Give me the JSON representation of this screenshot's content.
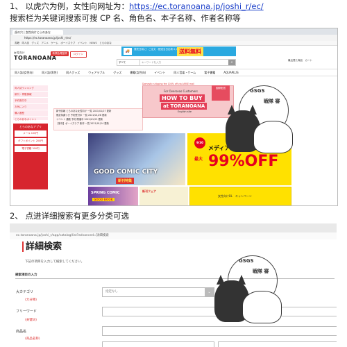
{
  "notes": {
    "step1_prefix": "1、 以虎穴为例，女性向网址为：",
    "step1_url": "https://ec.toranoana.jp/joshi_r/ec/",
    "step1_line2": "搜索栏为关键词搜索可搜 CP 名、角色名、本子名称、作者名称等",
    "step2": "2、 点进详细搜索有更多分类可选"
  },
  "shot1": {
    "tab_title": "虎の穴 | 女性向けとらのあな",
    "address": "https://ec.toranoana.jp/joshi_r/ec/",
    "bookmarks": "書籍　同人誌　グッズ　アニメ　ゲーム　ボーイズラブ　イベント　NEWS　とらのあな",
    "logo": "TORANOANA",
    "logo_sub": "女性向け",
    "header_button_1": "新規会員登録",
    "header_button_2": "ログイン",
    "banner_text": "発売日前に！ご注文・配送当日出荷\n2,000円(税込)以上",
    "banner_sale": "送料無料",
    "search_select": "すべて",
    "search_placeholder": "キーワードを入力",
    "search_icon": "magnifier-icon",
    "header_right": "最近見た商品　カート",
    "nav": [
      "同人誌(女性向)",
      "同人誌(男性)",
      "同人グッズ",
      "ウェアラブル",
      "グッズ",
      "書籍(女性向)",
      "イベント",
      "同人音楽・ゲーム",
      "電子書籍",
      "AQUAPLUS"
    ],
    "side_menu": [
      "同人誌ランキング",
      "新刊・再販情報",
      "予約受付中",
      "お気に入り",
      "購入履歴",
      "とらのあなポイント"
    ],
    "side_promo_caption": "とらのあなアプリ",
    "side_promo_items": [
      "メール 100円",
      "ギフトポイント 200円",
      "電子書籍 300円"
    ],
    "news_lines": [
      "新刊情報 とらのあな女性向け 一覧 2021/01/27 更新",
      "限定特典つき 予約受付中 一覧 2021/01/26 更新",
      "イベント 通販 予約 開催中 2021/01/25 更新",
      "【新刊】ボーイズラブ 新作 一覧 2021/01/24 更新"
    ],
    "howto_line1": "For Overseas Customers",
    "howto_line2": "HOW TO BUY",
    "howto_line3": "at TORANOANA",
    "howto_line4": "English site",
    "intl_shipping": "Domestic shipping fee 100% off via AIRSE mail",
    "howto_ribbon": "国際配送",
    "comic_title": "GOOD COMIC CITY",
    "comic_sub": "新刊特集",
    "sale_date": "9/30",
    "sale_title": "メディア・玩具 SALE",
    "sale_max": "最大",
    "sale_value": "99%OFF",
    "bot1_title": "SPRING COMIC",
    "bot1_sub": "GOOD BOOK",
    "bot2_title": "新刊フェア",
    "bot3_title": "女性向けBL　キャンペーン"
  },
  "shot2": {
    "url": "ec.toranoana.jp/joshi_r/app/catalog/list?advanced=詳細検索",
    "title": "詳細検索",
    "subtitle": "下記の項目を入力して検索してください。",
    "section": "検索項目の入力",
    "category_label": "大カテゴリ",
    "category_sub": "(大分類)",
    "category_value": "指定なし",
    "category_arrow_icon": "chevron-down-icon",
    "freeword_label": "フリーワード",
    "freeword_sub": "(关键词)",
    "product_label": "商品名",
    "product_sub": "(商品名称)"
  },
  "watermark": {
    "arc_text": "GSGS",
    "arc_text2": "戦隊 審",
    "stamp_text": "審"
  }
}
